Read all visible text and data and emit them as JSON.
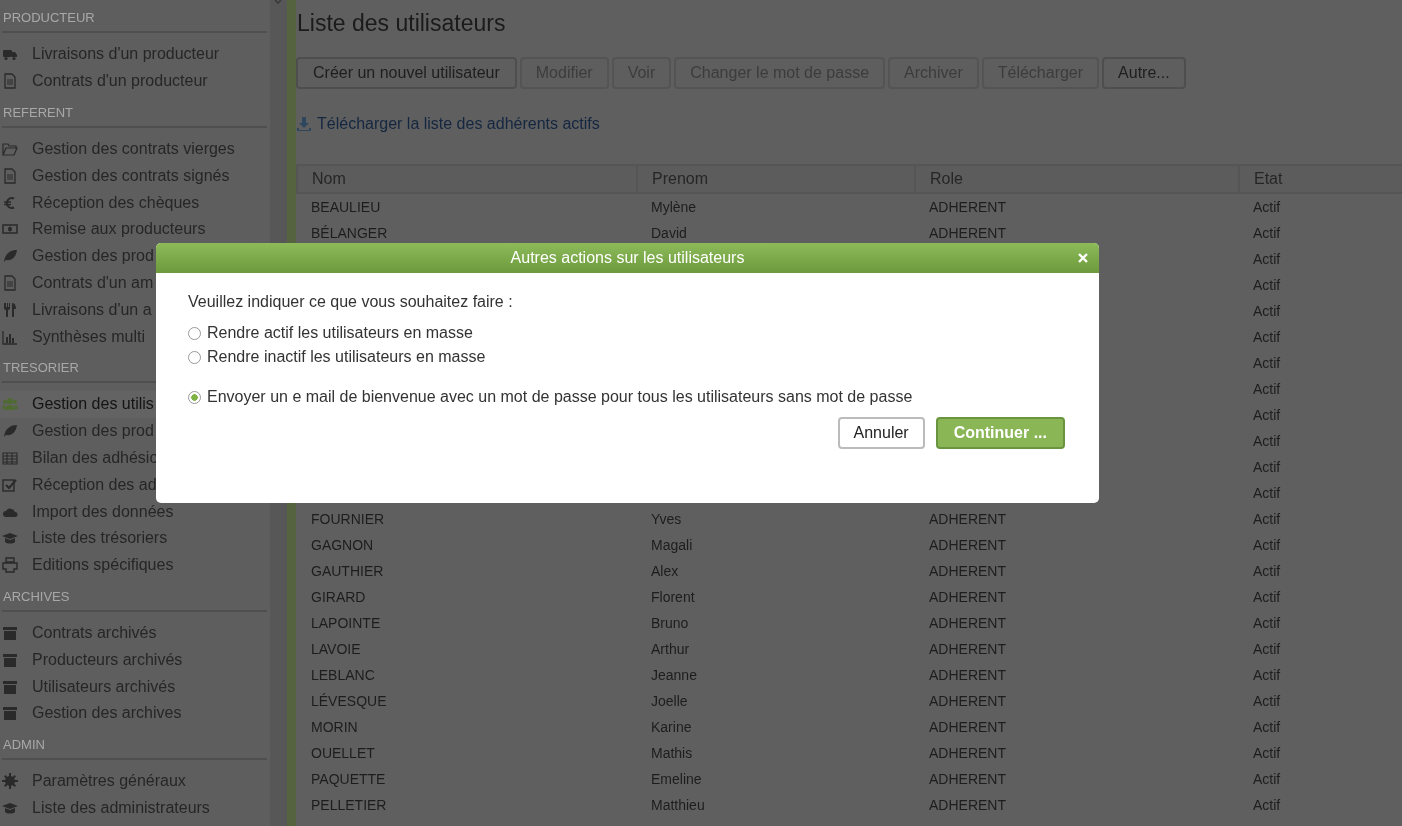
{
  "sidebar": {
    "sections": [
      {
        "title": "PRODUCTEUR",
        "items": [
          {
            "label": "Livraisons d'un producteur",
            "selected": false
          },
          {
            "label": "Contrats d'un producteur",
            "selected": false
          }
        ]
      },
      {
        "title": "REFERENT",
        "items": [
          {
            "label": "Gestion des contrats vierges",
            "selected": false
          },
          {
            "label": "Gestion des contrats signés",
            "selected": false
          },
          {
            "label": "Réception des chèques",
            "selected": false
          },
          {
            "label": "Remise aux producteurs",
            "selected": false
          },
          {
            "label": "Gestion des prod",
            "selected": false
          },
          {
            "label": "Contrats d'un am",
            "selected": false
          },
          {
            "label": "Livraisons d'un a",
            "selected": false
          },
          {
            "label": "Synthèses multi",
            "selected": false
          }
        ]
      },
      {
        "title": "TRESORIER",
        "items": [
          {
            "label": "Gestion des utilis",
            "selected": true
          },
          {
            "label": "Gestion des prod",
            "selected": false
          },
          {
            "label": "Bilan des adhésio",
            "selected": false
          },
          {
            "label": "Réception des ad",
            "selected": false
          },
          {
            "label": "Import des données",
            "selected": false
          },
          {
            "label": "Liste des trésoriers",
            "selected": false
          },
          {
            "label": "Editions spécifiques",
            "selected": false
          }
        ]
      },
      {
        "title": "ARCHIVES",
        "items": [
          {
            "label": "Contrats archivés",
            "selected": false
          },
          {
            "label": "Producteurs archivés",
            "selected": false
          },
          {
            "label": "Utilisateurs archivés",
            "selected": false
          },
          {
            "label": "Gestion des archives",
            "selected": false
          }
        ]
      },
      {
        "title": "ADMIN",
        "items": [
          {
            "label": "Paramètres généraux",
            "selected": false
          },
          {
            "label": "Liste des administrateurs",
            "selected": false
          }
        ]
      }
    ]
  },
  "page": {
    "title": "Liste des utilisateurs",
    "toolbar": [
      {
        "label": "Créer un nouvel utilisateur",
        "disabled": false
      },
      {
        "label": "Modifier",
        "disabled": true
      },
      {
        "label": "Voir",
        "disabled": true
      },
      {
        "label": "Changer le mot de passe",
        "disabled": true
      },
      {
        "label": "Archiver",
        "disabled": true
      },
      {
        "label": "Télécharger",
        "disabled": true
      },
      {
        "label": "Autre...",
        "disabled": false
      }
    ],
    "download_link": "Télécharger la liste des adhérents actifs",
    "table": {
      "columns": [
        "Nom",
        "Prenom",
        "Role",
        "Etat"
      ],
      "rows": [
        {
          "nom": "BEAULIEU",
          "prenom": "Mylène",
          "role": "ADHERENT",
          "etat": "Actif"
        },
        {
          "nom": "BÉLANGER",
          "prenom": "David",
          "role": "ADHERENT",
          "etat": "Actif"
        },
        {
          "etat": "Actif"
        },
        {
          "etat": "Actif"
        },
        {
          "etat": "Actif"
        },
        {
          "etat": "Actif"
        },
        {
          "etat": "Actif"
        },
        {
          "etat": "Actif"
        },
        {
          "etat": "Actif"
        },
        {
          "etat": "Actif"
        },
        {
          "etat": "Actif"
        },
        {
          "etat": "Actif"
        },
        {
          "nom": "FOURNIER",
          "prenom": "Yves",
          "role": "ADHERENT",
          "etat": "Actif"
        },
        {
          "nom": "GAGNON",
          "prenom": "Magali",
          "role": "ADHERENT",
          "etat": "Actif"
        },
        {
          "nom": "GAUTHIER",
          "prenom": "Alex",
          "role": "ADHERENT",
          "etat": "Actif"
        },
        {
          "nom": "GIRARD",
          "prenom": "Florent",
          "role": "ADHERENT",
          "etat": "Actif"
        },
        {
          "nom": "LAPOINTE",
          "prenom": "Bruno",
          "role": "ADHERENT",
          "etat": "Actif"
        },
        {
          "nom": "LAVOIE",
          "prenom": "Arthur",
          "role": "ADHERENT",
          "etat": "Actif"
        },
        {
          "nom": "LEBLANC",
          "prenom": "Jeanne",
          "role": "ADHERENT",
          "etat": "Actif"
        },
        {
          "nom": "LÉVESQUE",
          "prenom": "Joelle",
          "role": "ADHERENT",
          "etat": "Actif"
        },
        {
          "nom": "MORIN",
          "prenom": "Karine",
          "role": "ADHERENT",
          "etat": "Actif"
        },
        {
          "nom": "OUELLET",
          "prenom": "Mathis",
          "role": "ADHERENT",
          "etat": "Actif"
        },
        {
          "nom": "PAQUETTE",
          "prenom": "Emeline",
          "role": "ADHERENT",
          "etat": "Actif"
        },
        {
          "nom": "PELLETIER",
          "prenom": "Matthieu",
          "role": "ADHERENT",
          "etat": "Actif"
        }
      ]
    }
  },
  "dialog": {
    "title": "Autres actions sur les utilisateurs",
    "prompt": "Veuillez indiquer ce que vous souhaitez faire :",
    "options": [
      {
        "label": "Rendre actif les utilisateurs en masse",
        "selected": false
      },
      {
        "label": "Rendre inactif les utilisateurs en masse",
        "selected": false
      },
      {
        "label": "Envoyer un e mail de bienvenue avec un mot de passe pour tous les utilisateurs sans mot de passe",
        "selected": true
      }
    ],
    "cancel": "Annuler",
    "continue": "Continuer ..."
  }
}
